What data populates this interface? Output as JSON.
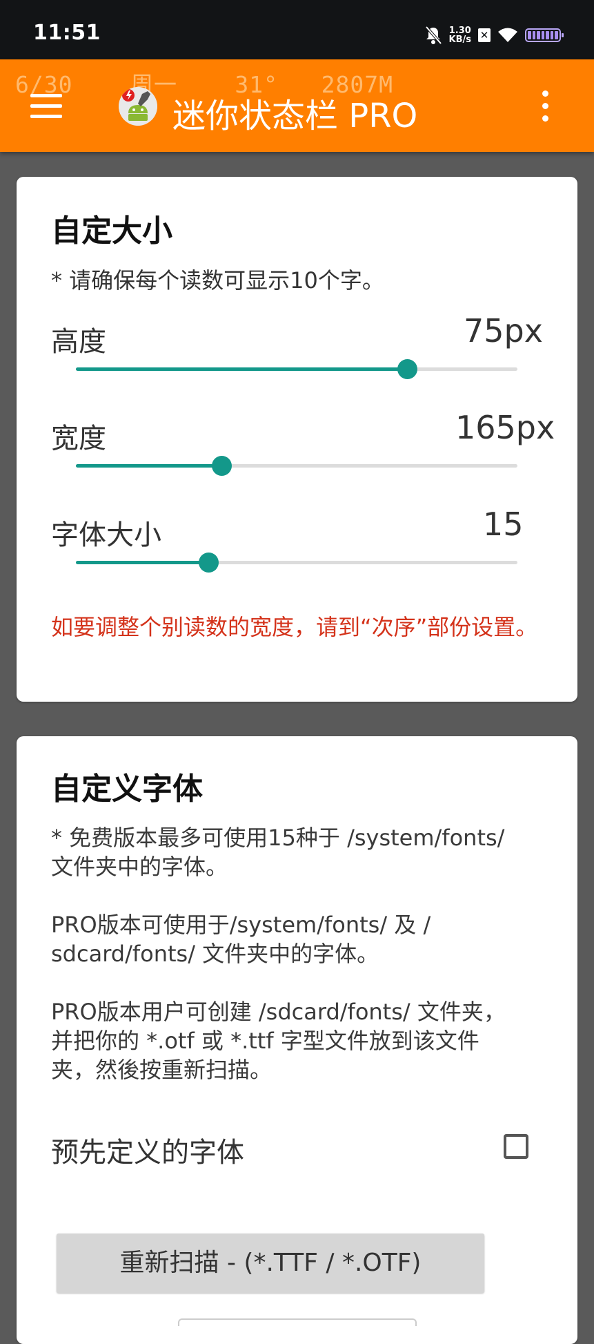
{
  "status_bar": {
    "time": "11:51",
    "net_speed_value": "1.30",
    "net_speed_unit": "KB/s",
    "icons": [
      "mute-bell-icon",
      "x-box-icon",
      "wifi-icon",
      "battery-icon"
    ],
    "background": "#121416"
  },
  "overlay": {
    "text": "6/30    周一    31°   2807M"
  },
  "app_bar": {
    "title": "迷你状态栏 PRO",
    "color": "#ff7f00",
    "menu_icon": "hamburger-menu-icon",
    "more_icon": "more-vert-icon"
  },
  "size_card": {
    "title": "自定大小",
    "note": "* 请确保每个读数可显示10个字。",
    "sliders": [
      {
        "label": "高度",
        "value": "75px",
        "fraction": 0.75
      },
      {
        "label": "宽度",
        "value": "165px",
        "fraction": 0.33
      },
      {
        "label": "字体大小",
        "value": "15",
        "fraction": 0.3
      }
    ],
    "warning": "如要调整个别读数的宽度，请到“次序”部份设置。",
    "accent_color": "#13988a",
    "warning_color": "#d4331b"
  },
  "font_card": {
    "title": "自定义字体",
    "paragraphs": [
      "* 免费版本最多可使用15种于 /system/fonts/\n文件夹中的字体。",
      "PRO版本可使用于/system/fonts/ 及 /\nsdcard/fonts/ 文件夹中的字体。",
      "PRO版本用户可创建 /sdcard/fonts/ 文件夹，\n并把你的 *.otf 或 *.ttf 字型文件放到该文件\n夹，然後按重新扫描。"
    ],
    "predefined_label": "预先定义的字体",
    "predefined_checked": false,
    "rescan_label": "重新扫描 - (*.TTF / *.OTF)"
  }
}
